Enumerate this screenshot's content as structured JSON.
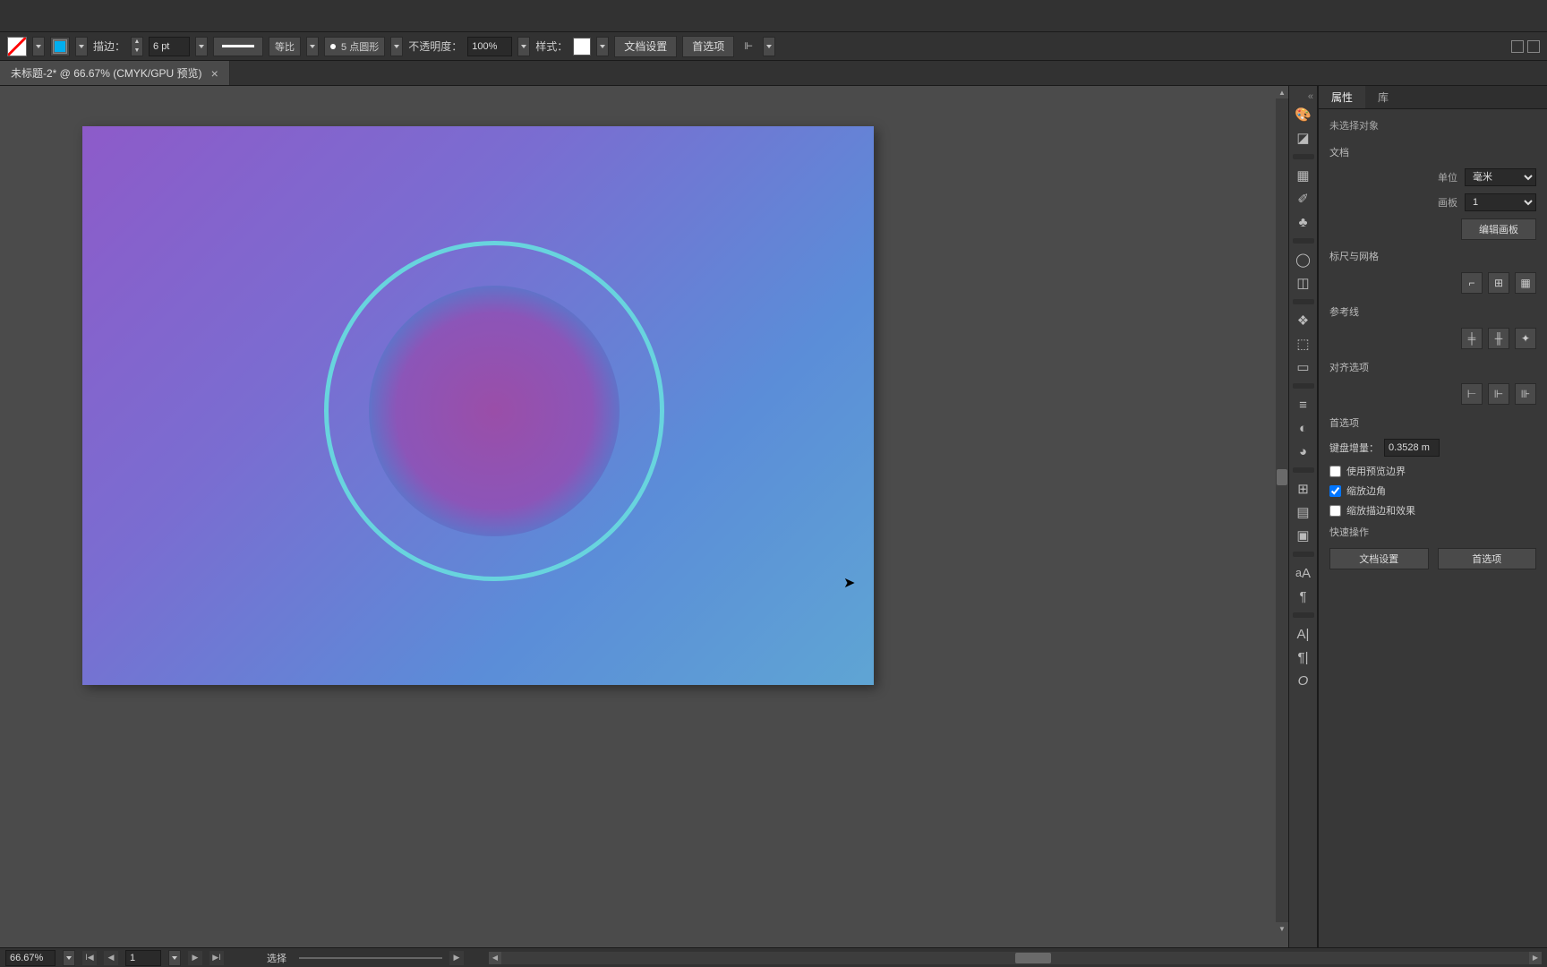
{
  "control_bar": {
    "stroke_label": "描边：",
    "stroke_width": "6 pt",
    "stroke_align_label": "等比",
    "profile_label": "5 点圆形",
    "opacity_label": "不透明度：",
    "opacity_value": "100%",
    "style_label": "样式：",
    "doc_setup_btn": "文档设置",
    "prefs_btn": "首选项"
  },
  "tab": {
    "title": "未标题-2* @ 66.67% (CMYK/GPU 预览)"
  },
  "right_panel": {
    "tabs": {
      "properties": "属性",
      "library": "库"
    },
    "selection_status": "未选择对象",
    "doc_section": "文档",
    "unit_label": "单位",
    "unit_value": "毫米",
    "artboard_label": "画板",
    "artboard_value": "1",
    "edit_artboard_btn": "编辑画板",
    "ruler_grid": "标尺与网格",
    "guides": "参考线",
    "align_options": "对齐选项",
    "prefs_section": "首选项",
    "kbd_increment_label": "键盘增量：",
    "kbd_increment_value": "0.3528 m",
    "use_preview_bounds": "使用预览边界",
    "scale_corners": "缩放边角",
    "scale_strokes": "缩放描边和效果",
    "quick_actions": "快速操作",
    "doc_setup_btn": "文档设置",
    "prefs_btn": "首选项"
  },
  "status_bar": {
    "zoom": "66.67%",
    "artboard_nav": "1",
    "tool_status": "选择"
  }
}
